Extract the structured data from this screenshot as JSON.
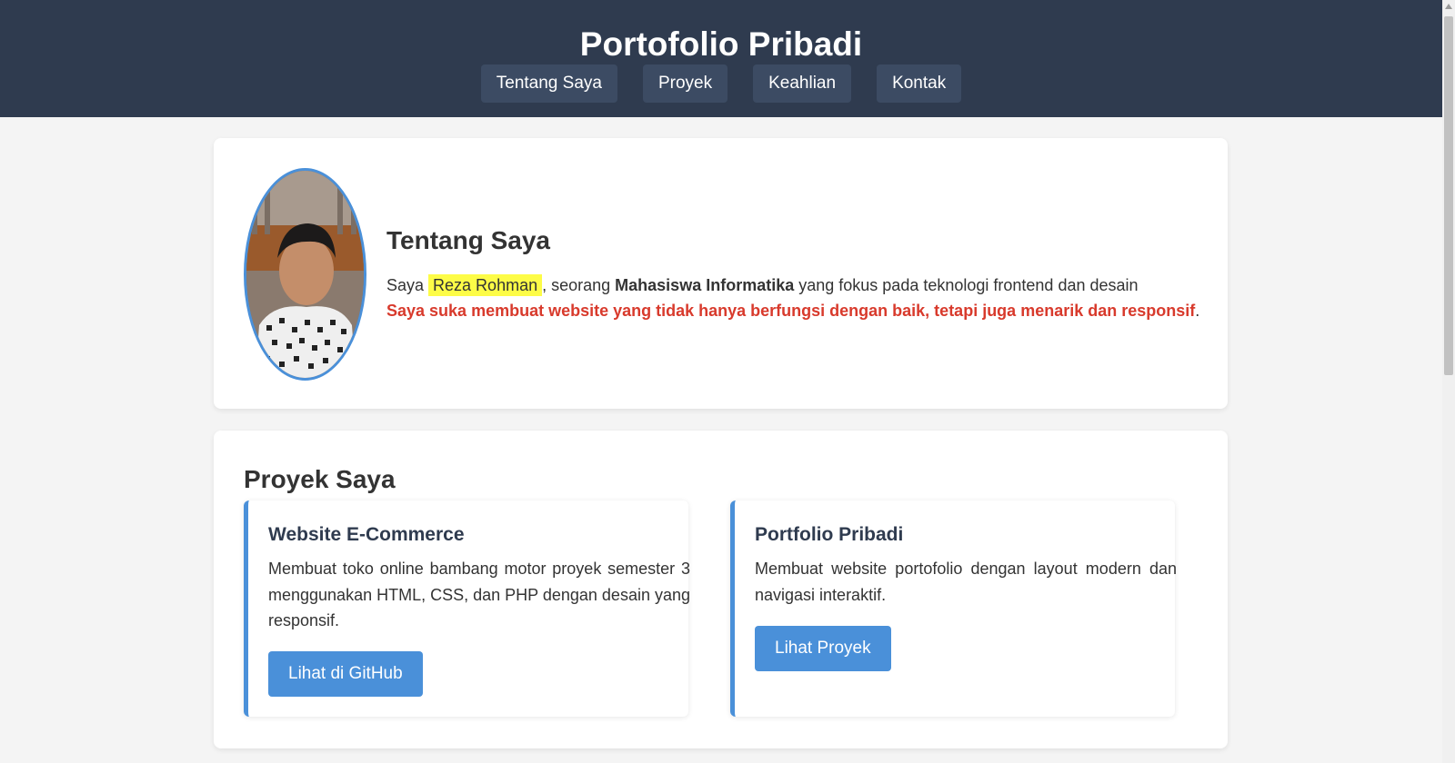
{
  "header": {
    "title": "Portofolio Pribadi",
    "nav": [
      "Tentang Saya",
      "Proyek",
      "Keahlian",
      "Kontak"
    ]
  },
  "about": {
    "heading": "Tentang Saya",
    "intro_prefix": "Saya ",
    "name": "Reza Rohman",
    "intro_mid": ", seorang ",
    "role": "Mahasiswa Informatika",
    "intro_suffix": " yang fokus pada teknologi frontend dan desain",
    "highlight_sentence": "Saya suka membuat website yang tidak hanya berfungsi dengan baik, tetapi juga menarik dan responsif",
    "period": "."
  },
  "projects": {
    "heading": "Proyek Saya",
    "items": [
      {
        "title": "Website E-Commerce",
        "description": "Membuat toko online bambang motor proyek semester 3 menggunakan HTML, CSS, dan PHP dengan desain yang responsif.",
        "button": "Lihat di GitHub"
      },
      {
        "title": "Portfolio Pribadi",
        "description": "Membuat website portofolio dengan layout modern dan navigasi interaktif.",
        "button": "Lihat Proyek"
      }
    ]
  },
  "colors": {
    "header_bg": "#2f3b4f",
    "accent": "#4a90d9",
    "highlight": "#fdfc47",
    "emphasis_red": "#d83a2c"
  }
}
